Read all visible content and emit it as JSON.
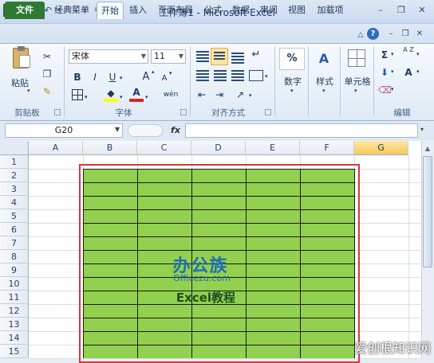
{
  "window": {
    "title": "工作簿1 - Microsoft Excel"
  },
  "tabs": {
    "file": "文件",
    "classic": "经典菜单",
    "home": "开始",
    "insert": "插入",
    "layout": "页面布局",
    "formulas": "公式",
    "data": "数据",
    "review": "审阅",
    "view": "视图",
    "addins": "加载项"
  },
  "clipboard": {
    "paste": "粘贴",
    "label": "剪贴板"
  },
  "font": {
    "name": "宋体",
    "size": "11",
    "bold": "B",
    "italic": "I",
    "underline": "U",
    "grow": "A",
    "shrink": "A",
    "color": "A",
    "phonetic": "wén",
    "label": "字体"
  },
  "alignment": {
    "label": "对齐方式"
  },
  "number": {
    "format": "%",
    "label": "数字"
  },
  "styles": {
    "label": "样式"
  },
  "cells": {
    "label": "单元格"
  },
  "editing": {
    "sigma": "Σ",
    "sort": "A Z",
    "find": "A",
    "label": "编辑"
  },
  "formula_bar": {
    "name_box": "G20",
    "fx": "fx",
    "value": ""
  },
  "columns": [
    "A",
    "B",
    "C",
    "D",
    "E",
    "F",
    "G"
  ],
  "selected_column": "G",
  "rows": [
    "1",
    "2",
    "3",
    "4",
    "5",
    "6",
    "7",
    "8",
    "9",
    "10",
    "11",
    "12",
    "13",
    "14",
    "15"
  ],
  "fill_color": "#92d050",
  "border_color": "#d23a3a",
  "watermark": {
    "logo": "办公族",
    "site": "Officezu.com",
    "caption": "Excel教程"
  },
  "corner_watermark": "爱创根知识网"
}
